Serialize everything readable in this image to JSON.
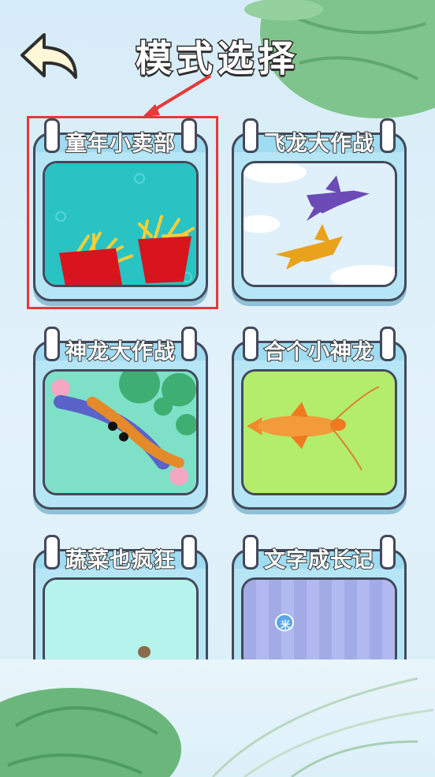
{
  "header": {
    "title": "模式选择",
    "back_icon": "back-arrow-icon"
  },
  "highlight_color": "#e63939",
  "modes": [
    {
      "label": "童年小卖部",
      "art": "french-fries",
      "bg": "#2ac3c3",
      "highlighted": true
    },
    {
      "label": "飞龙大作战",
      "art": "flying-dragons",
      "bg": "#dff0fb",
      "highlighted": false
    },
    {
      "label": "神龙大作战",
      "art": "koi-pond",
      "bg": "#7fe0c8",
      "highlighted": false
    },
    {
      "label": "合个小神龙",
      "art": "golden-fish",
      "bg": "#b4ec6c",
      "highlighted": false
    },
    {
      "label": "蔬菜也疯狂",
      "art": "vegetables",
      "bg": "#b5f3ec",
      "highlighted": false
    },
    {
      "label": "文字成长记",
      "art": "character-growth",
      "bg": "#b1b9f0",
      "highlighted": false
    }
  ],
  "word_badge": "米"
}
